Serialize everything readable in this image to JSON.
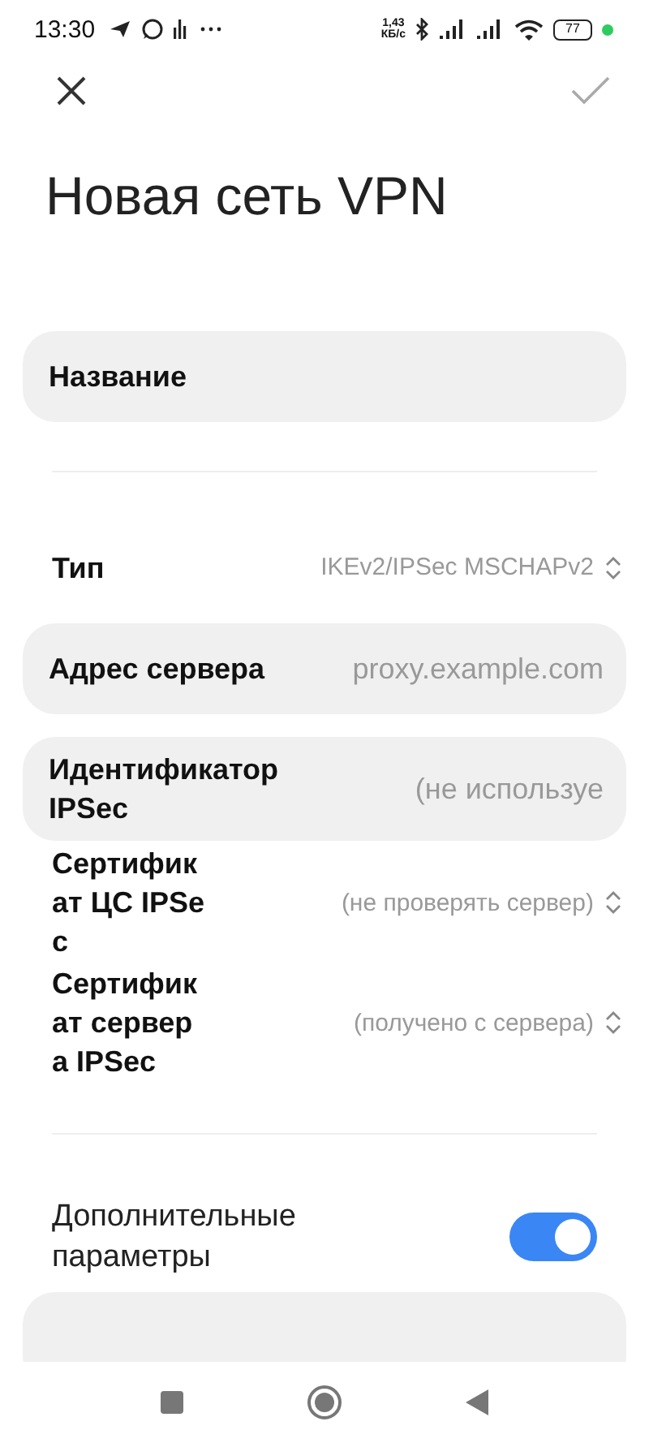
{
  "status_bar": {
    "time": "13:30",
    "speed": "1,43",
    "speed_unit": "КБ/с",
    "battery": "77"
  },
  "title": "Новая сеть VPN",
  "fields": [
    {
      "kind": "input",
      "label": "Название"
    },
    {
      "kind": "divider"
    },
    {
      "kind": "select",
      "label": "Тип",
      "value": "IKEv2/IPSec MSCHAPv2"
    },
    {
      "kind": "input",
      "label": "Адрес сервера",
      "placeholder": "proxy.example.com"
    },
    {
      "kind": "input",
      "label": "Идентификатор IPSec",
      "placeholder": "(не используе"
    },
    {
      "kind": "select",
      "label": "Сертификат ЦС IPSec",
      "value": "(не проверять сервер)"
    },
    {
      "kind": "select",
      "label": "Сертификат сервера IPSec",
      "value": "(получено с сервера)"
    },
    {
      "kind": "divider"
    },
    {
      "kind": "toggle",
      "label": "Дополнительные параметры",
      "on": true
    },
    {
      "kind": "card"
    }
  ]
}
